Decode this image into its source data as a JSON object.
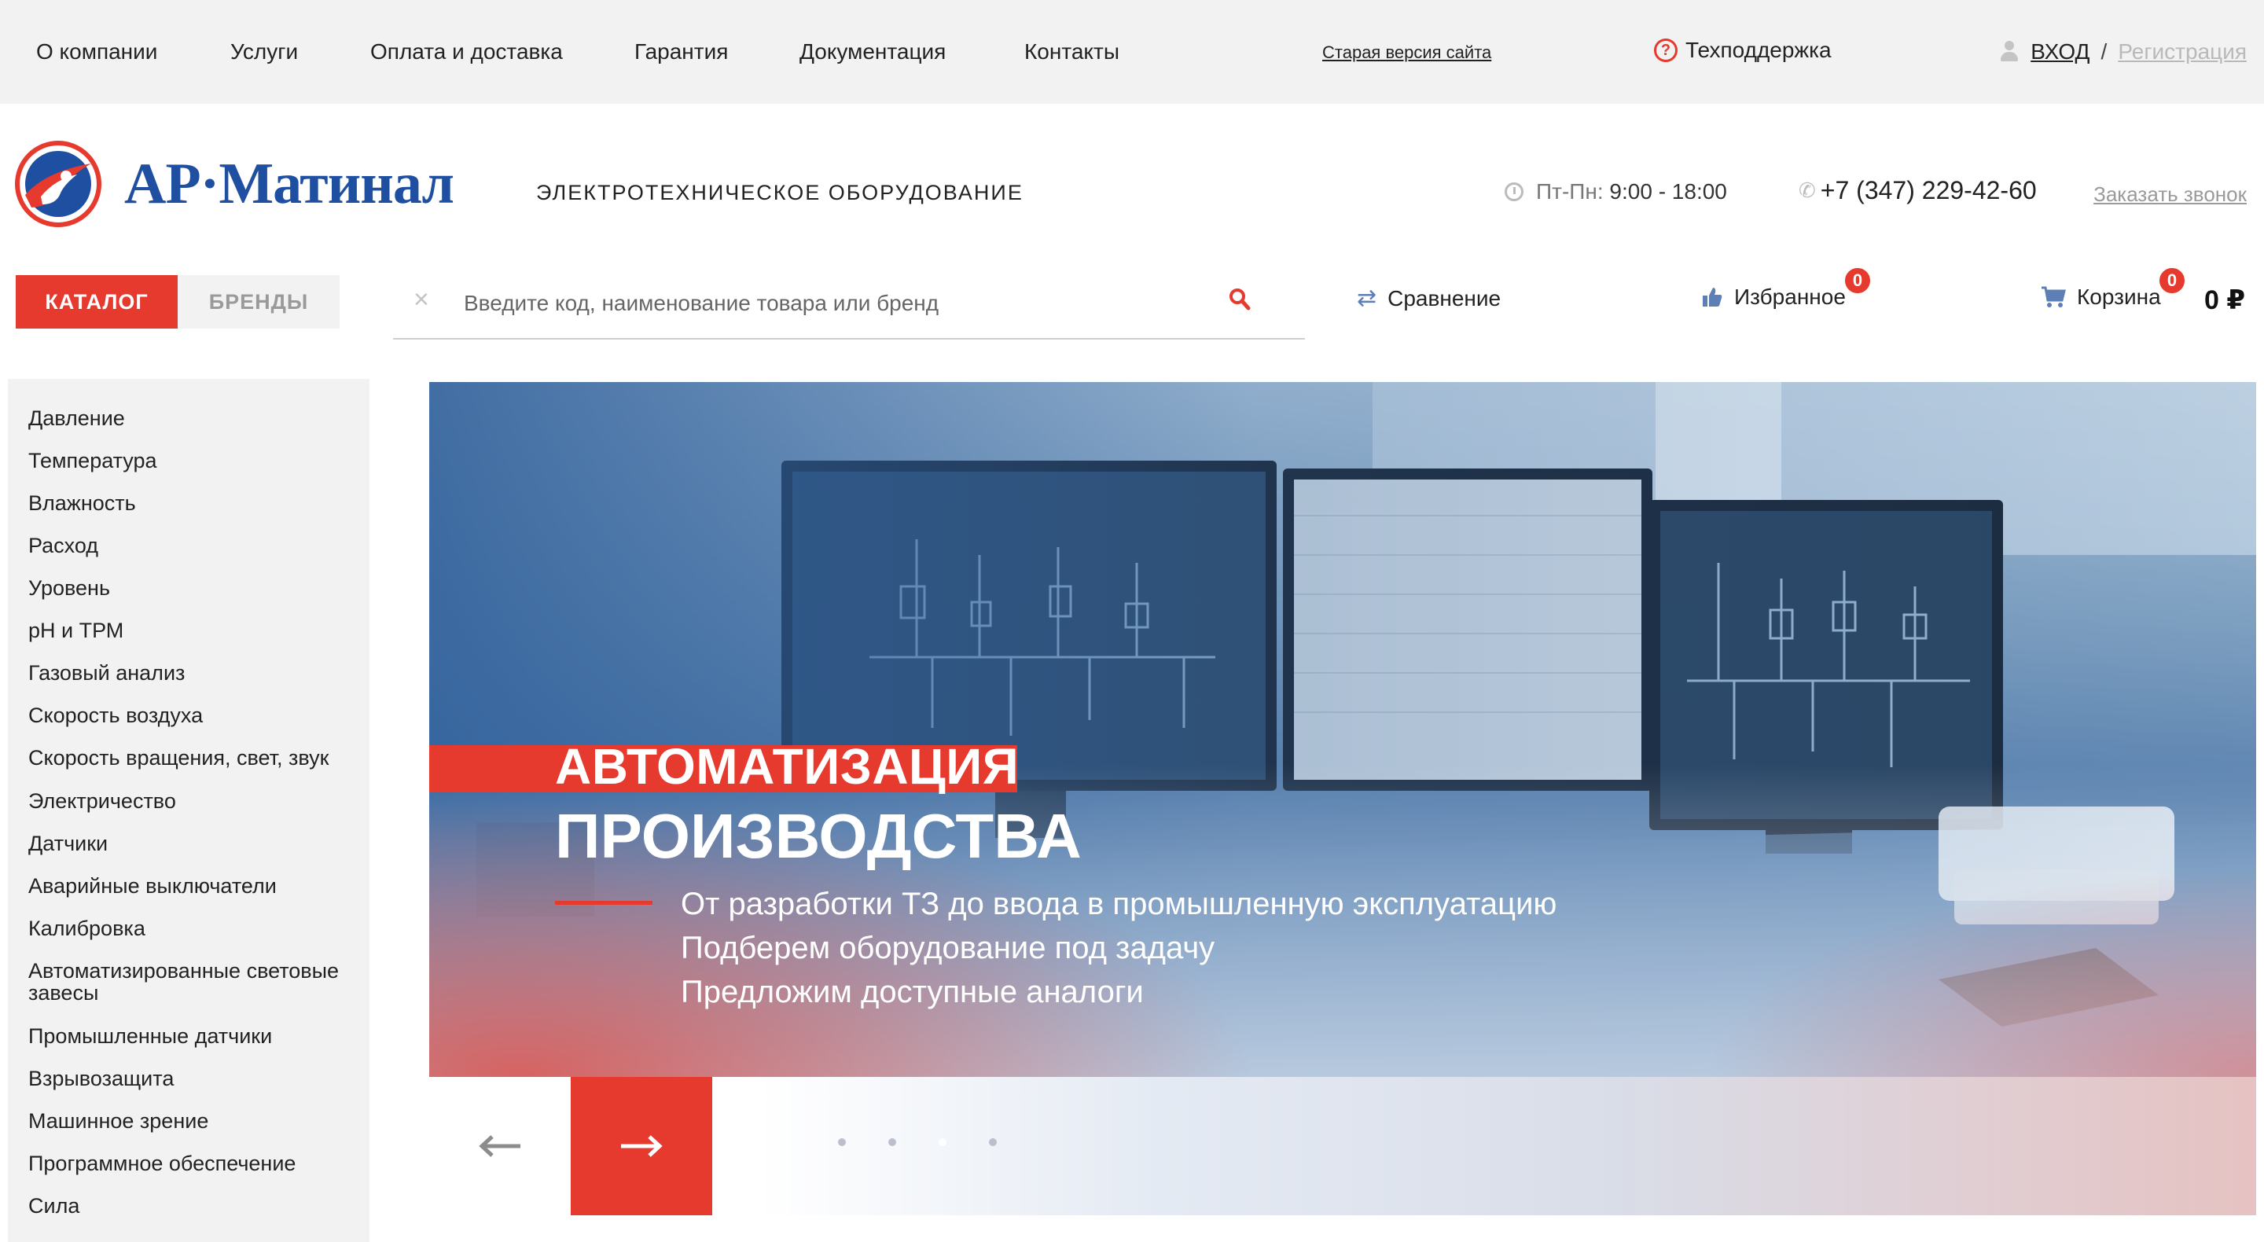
{
  "topnav": {
    "items": [
      "О компании",
      "Услуги",
      "Оплата и доставка",
      "Гарантия",
      "Документация",
      "Контакты"
    ],
    "old_site": "Старая версия сайта",
    "support": "Техподдержка",
    "login": "ВХОД",
    "separator": "/",
    "register": "Регистрация"
  },
  "header": {
    "logo_text": "АР·Матинал",
    "tagline": "ЭЛЕКТРОТЕХНИЧЕСКОЕ ОБОРУДОВАНИЕ",
    "hours_label": "Пт-Пн:",
    "hours_value": "9:00 - 18:00",
    "phone": "+7 (347) 229-42-60",
    "callback": "Заказать звонок"
  },
  "tabs": {
    "catalog": "КАТАЛОГ",
    "brands": "БРЕНДЫ"
  },
  "search": {
    "placeholder": "Введите код, наименование товара или бренд",
    "value": ""
  },
  "actions": {
    "compare": "Сравнение",
    "favorites": "Избранное",
    "favorites_count": "0",
    "cart": "Корзина",
    "cart_count": "0",
    "cart_total": "0 ₽"
  },
  "sidebar": {
    "items": [
      "Давление",
      "Температура",
      "Влажность",
      "Расход",
      "Уровень",
      "pH и ТРМ",
      "Газовый анализ",
      "Скорость воздуха",
      "Скорость вращения, свет, звук",
      "Электричество",
      "Датчики",
      "Аварийные выключатели",
      "Калибровка",
      "Автоматизированные световые завесы",
      "Промышленные датчики",
      "Взрывозащита",
      "Машинное зрение",
      "Программное обеспечение",
      "Сила"
    ]
  },
  "hero": {
    "title_line1": "АВТОМАТИЗАЦИЯ",
    "title_line2": "ПРОИЗВОДСТВА",
    "subtitle_lines": [
      "От разработки ТЗ до ввода в промышленную эксплуатацию",
      "Подберем оборудование под задачу",
      "Предложим доступные аналоги"
    ]
  },
  "slider": {
    "dot_count": 4,
    "active_dot": 3
  },
  "colors": {
    "accent": "#e63a2e",
    "brand_blue": "#1f4fa0",
    "topbar_bg": "#f2f2f2",
    "muted": "#9a9a9a"
  },
  "icons": {
    "support": "question-circle-icon",
    "user": "user-icon",
    "clock": "clock-icon",
    "phone": "phone-icon",
    "search": "search-icon",
    "clear": "close-icon",
    "compare": "compare-arrows-icon",
    "favorites": "thumbs-up-icon",
    "cart": "cart-icon",
    "prev": "arrow-left-icon",
    "next": "arrow-right-icon"
  }
}
